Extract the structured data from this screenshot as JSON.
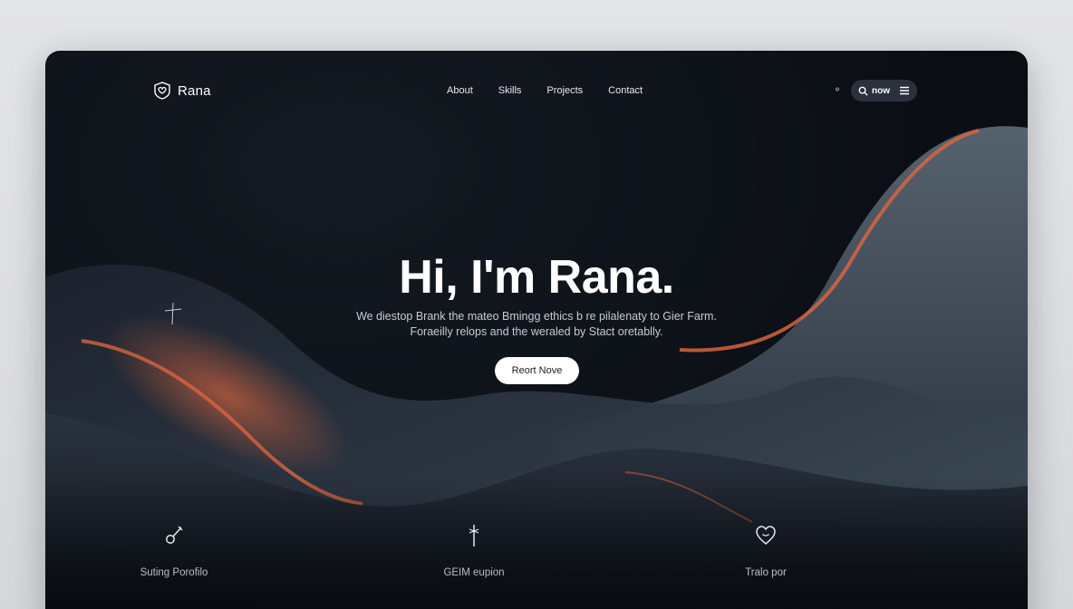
{
  "brand": {
    "name": "Rana"
  },
  "nav": {
    "items": [
      "About",
      "Skills",
      "Projects",
      "Contact"
    ]
  },
  "toolbar": {
    "glyph": "ᵠ",
    "pill_label": "now"
  },
  "hero": {
    "title": "Hi, I'm Rana.",
    "subtitle_line1": "We diestop Brank the mateo Bmingg ethics b re pilalenaty to Gier Farm.",
    "subtitle_line2": "Foraeilly relops and the weraled by Stact oretablly.",
    "cta_label": "Reort Nove"
  },
  "features": [
    {
      "icon": "guitar-icon",
      "label": "Suting Porofilo"
    },
    {
      "icon": "antenna-icon",
      "label": "GEIM eupion"
    },
    {
      "icon": "heart-icon",
      "label": "Tralo por"
    }
  ],
  "colors": {
    "accent": "#d8643f",
    "background": "#0b0f15",
    "wave": "#3b4655"
  }
}
